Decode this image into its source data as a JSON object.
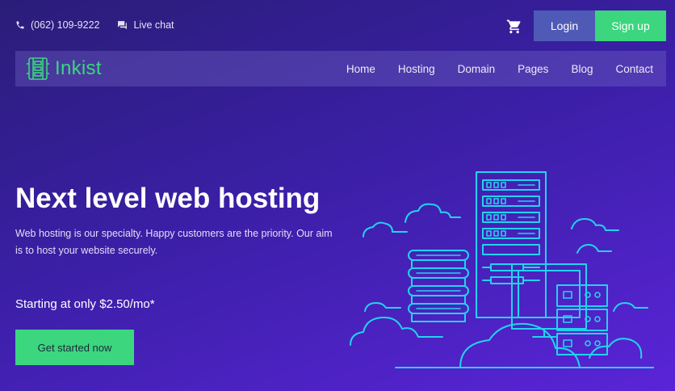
{
  "topbar": {
    "phone": "(062) 109-9222",
    "chat_label": "Live chat",
    "login_label": "Login",
    "signup_label": "Sign up"
  },
  "brand": {
    "name": "Inkist",
    "accent_color": "#3bd67e"
  },
  "nav": {
    "items": [
      "Home",
      "Hosting",
      "Domain",
      "Pages",
      "Blog",
      "Contact"
    ]
  },
  "hero": {
    "title": "Next level web hosting",
    "description": "Web hosting is our specialty. Happy customers are the priority. Our aim is to host your website securely.",
    "price_text": "Starting at only $2.50/mo*",
    "cta_label": "Get started now"
  },
  "icons": {
    "phone": "phone-icon",
    "chat": "chat-icon",
    "cart": "cart-icon",
    "logo": "server-logo-icon"
  }
}
